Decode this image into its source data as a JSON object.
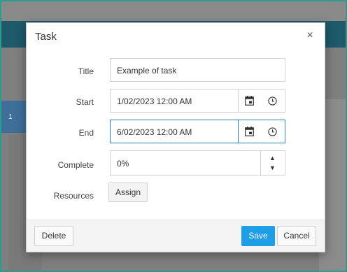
{
  "app": {
    "side_tab_label": "1"
  },
  "dialog": {
    "title": "Task",
    "close_glyph": "×",
    "fields": {
      "title": {
        "label": "Title",
        "value": "Example of task"
      },
      "start": {
        "label": "Start",
        "value": "1/02/2023 12:00 AM"
      },
      "end": {
        "label": "End",
        "value": "6/02/2023 12:00 AM"
      },
      "complete": {
        "label": "Complete",
        "value": "0%"
      },
      "resources": {
        "label": "Resources",
        "button_label": "Assign"
      }
    },
    "spinner": {
      "up_glyph": "▲",
      "down_glyph": "▼"
    },
    "footer": {
      "delete_label": "Delete",
      "save_label": "Save",
      "cancel_label": "Cancel"
    }
  },
  "colors": {
    "accent": "#1e9ee6",
    "focus_border": "#2f7fbf",
    "frame": "#2a9d8f",
    "app_topbar": "#1d5a6a"
  },
  "icons": [
    "close-icon",
    "calendar-icon",
    "clock-icon",
    "spin-up-icon",
    "spin-down-icon"
  ]
}
